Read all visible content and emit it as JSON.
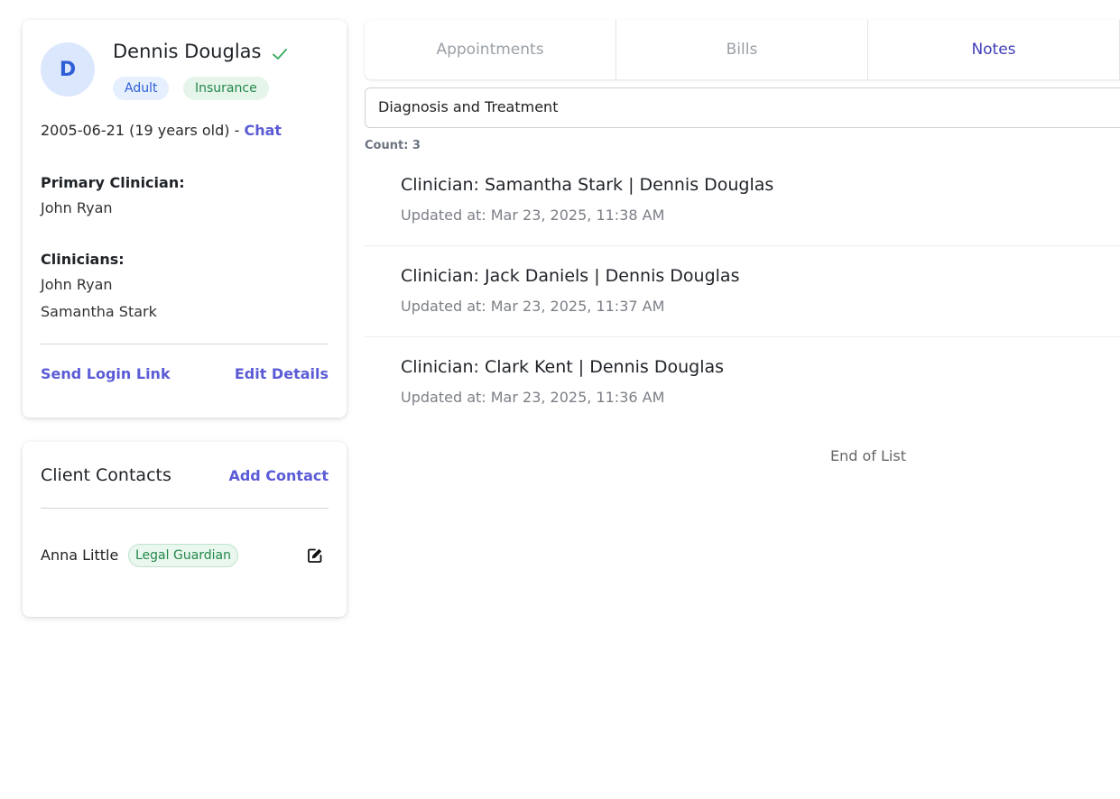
{
  "client": {
    "initial": "D",
    "name": "Dennis Douglas",
    "badges": [
      "Adult",
      "Insurance"
    ],
    "dob_text": "2005-06-21 (19 years old) - ",
    "chat_label": "Chat",
    "primary_clinician_label": "Primary Clinician:",
    "primary_clinician": "John Ryan",
    "clinicians_label": "Clinicians:",
    "clinicians": [
      "John Ryan",
      "Samantha Stark"
    ],
    "send_login_link": "Send Login Link",
    "edit_details": "Edit Details"
  },
  "contacts": {
    "title": "Client Contacts",
    "add_contact": "Add Contact",
    "items": [
      {
        "name": "Anna Little",
        "role": "Legal Guardian"
      }
    ]
  },
  "tabs": [
    {
      "label": "Appointments",
      "active": false
    },
    {
      "label": "Bills",
      "active": false
    },
    {
      "label": "Notes",
      "active": true
    }
  ],
  "notes": {
    "filter_value": "Diagnosis and Treatment",
    "count_label": "Count: 3",
    "items": [
      {
        "title": "Clinician: Samantha Stark | Dennis Douglas",
        "updated": "Updated at: Mar 23, 2025, 11:38 AM"
      },
      {
        "title": "Clinician: Jack Daniels | Dennis Douglas",
        "updated": "Updated at: Mar 23, 2025, 11:37 AM"
      },
      {
        "title": "Clinician: Clark Kent | Dennis Douglas",
        "updated": "Updated at: Mar 23, 2025, 11:36 AM"
      }
    ],
    "end_of_list": "End of List"
  },
  "colors": {
    "accent": "#5b5bd6",
    "active_tab": "#3f3fb8",
    "success_green": "#22874a",
    "avatar_bg": "#dbe7fd"
  },
  "icons": {
    "verified": "check-icon",
    "edit": "edit-icon"
  }
}
